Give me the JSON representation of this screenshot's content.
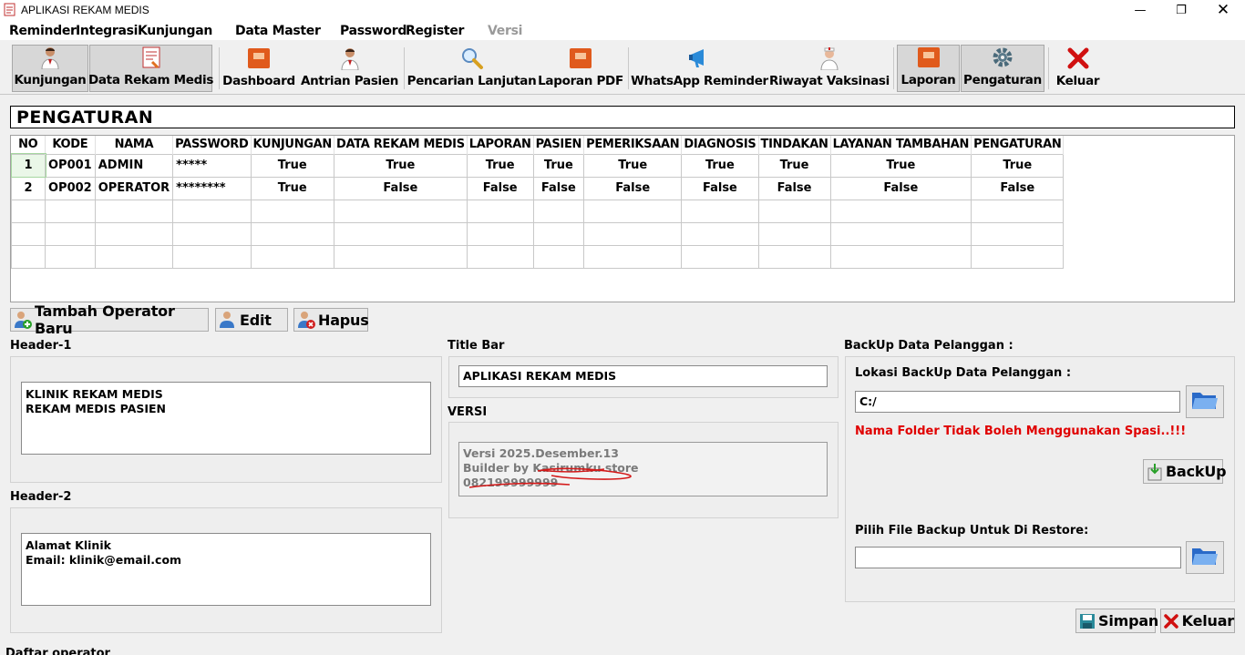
{
  "window": {
    "title": "APLIKASI REKAM MEDIS",
    "controls": {
      "minimize": "—",
      "maximize": "❐",
      "close": "✕"
    }
  },
  "menu": [
    {
      "label": "Reminder"
    },
    {
      "label": "Integrasi"
    },
    {
      "label": "Kunjungan"
    },
    {
      "label": "Data Master"
    },
    {
      "label": "Password"
    },
    {
      "label": "Register"
    },
    {
      "label": "Versi"
    }
  ],
  "toolbar": [
    {
      "label": "Kunjungan",
      "icon": "doctor-icon"
    },
    {
      "label": "Data Rekam Medis",
      "icon": "medical-record-icon"
    },
    {
      "label": "Dashboard",
      "icon": "report-book-icon"
    },
    {
      "label": "Antrian Pasien",
      "icon": "doctor-icon"
    },
    {
      "label": "Pencarian Lanjutan",
      "icon": "magnifier-icon"
    },
    {
      "label": "Laporan PDF",
      "icon": "report-book-icon"
    },
    {
      "label": "WhatsApp Reminder",
      "icon": "megaphone-icon"
    },
    {
      "label": "Riwayat Vaksinasi",
      "icon": "nurse-icon"
    },
    {
      "label": "Laporan",
      "icon": "report-book-icon"
    },
    {
      "label": "Pengaturan",
      "icon": "gear-icon"
    },
    {
      "label": "Keluar",
      "icon": "red-x-icon"
    }
  ],
  "page_title": "PENGATURAN",
  "table": {
    "columns": [
      "NO",
      "KODE",
      "NAMA",
      "PASSWORD",
      "KUNJUNGAN",
      "DATA REKAM MEDIS",
      "LAPORAN",
      "PASIEN",
      "PEMERIKSAAN",
      "DIAGNOSIS",
      "TINDAKAN",
      "LAYANAN TAMBAHAN",
      "PENGATURAN"
    ],
    "rows": [
      [
        "1",
        "OP001",
        "ADMIN",
        "*****",
        "True",
        "True",
        "True",
        "True",
        "True",
        "True",
        "True",
        "True",
        "True"
      ],
      [
        "2",
        "OP002",
        "OPERATOR",
        "********",
        "True",
        "False",
        "False",
        "False",
        "False",
        "False",
        "False",
        "False",
        "False"
      ]
    ]
  },
  "buttons": {
    "tambah": "Tambah Operator Baru",
    "edit": "Edit",
    "hapus": "Hapus",
    "backup": "BackUp",
    "simpan": "Simpan",
    "keluar": "Keluar"
  },
  "header1": {
    "label": "Header-1",
    "lines": [
      "KLINIK REKAM MEDIS",
      "REKAM MEDIS PASIEN"
    ]
  },
  "header2": {
    "label": "Header-2",
    "lines": [
      "Alamat Klinik",
      "Email: klinik@email.com"
    ]
  },
  "titlebar_setting": {
    "label": "Title Bar",
    "value": "APLIKASI REKAM MEDIS"
  },
  "versi": {
    "label": "VERSI",
    "lines": [
      "Versi 2025.Desember.13",
      "Builder by Kasirumku store",
      "082199999999"
    ]
  },
  "backup": {
    "section_label": "BackUp Data Pelanggan :",
    "lokasi_label": "Lokasi BackUp Data Pelanggan :",
    "lokasi_value": "C:/",
    "warning": "Nama Folder Tidak Boleh Menggunakan Spasi..!!!",
    "restore_label": "Pilih File Backup Untuk Di Restore:",
    "restore_value": ""
  },
  "footer_label": "Daftar operator",
  "colors": {
    "warning": "#e00000",
    "accent_red": "#d01010"
  }
}
